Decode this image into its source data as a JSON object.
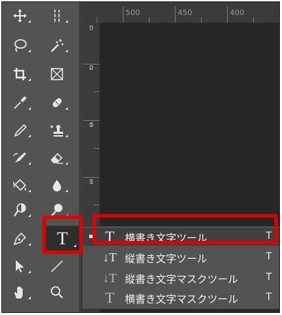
{
  "ruler": {
    "top_labels": [
      "500",
      "450",
      "400"
    ],
    "left_labels": [
      [
        "5",
        "0"
      ],
      [
        "2",
        "0",
        "0"
      ],
      [
        "1",
        "5",
        "0"
      ],
      [
        "1",
        "0",
        "0"
      ]
    ]
  },
  "toolbar": {
    "tools": [
      {
        "name": "move-tool"
      },
      {
        "name": "artboard-tool"
      },
      {
        "name": "lasso-tool"
      },
      {
        "name": "magic-wand-tool"
      },
      {
        "name": "crop-tool"
      },
      {
        "name": "frame-tool"
      },
      {
        "name": "eyedropper-tool"
      },
      {
        "name": "spot-healing-brush-tool"
      },
      {
        "name": "brush-tool"
      },
      {
        "name": "clone-stamp-tool"
      },
      {
        "name": "history-brush-tool"
      },
      {
        "name": "eraser-tool"
      },
      {
        "name": "paint-bucket-tool"
      },
      {
        "name": "blur-tool"
      },
      {
        "name": "dodge-tool"
      },
      {
        "name": "burn-tool"
      },
      {
        "name": "pen-tool"
      },
      {
        "name": "type-tool",
        "glyph": "T"
      },
      {
        "name": "path-selection-tool"
      },
      {
        "name": "line-tool"
      },
      {
        "name": "hand-tool"
      },
      {
        "name": "zoom-tool"
      }
    ]
  },
  "flyout": {
    "items": [
      {
        "icon": "T",
        "label": "横書き文字ツール",
        "shortcut": "T",
        "selected": true
      },
      {
        "icon": "↓T",
        "label": "縦書き文字ツール",
        "shortcut": "T",
        "selected": false
      },
      {
        "icon": "↓T",
        "label": "縦書き文字マスクツール",
        "shortcut": "T",
        "selected": false
      },
      {
        "icon": "T",
        "label": "横書き文字マスクツール",
        "shortcut": "T",
        "selected": false
      }
    ]
  },
  "colors": {
    "highlight": "#e00000",
    "panel": "#535353",
    "canvas": "#262626"
  }
}
